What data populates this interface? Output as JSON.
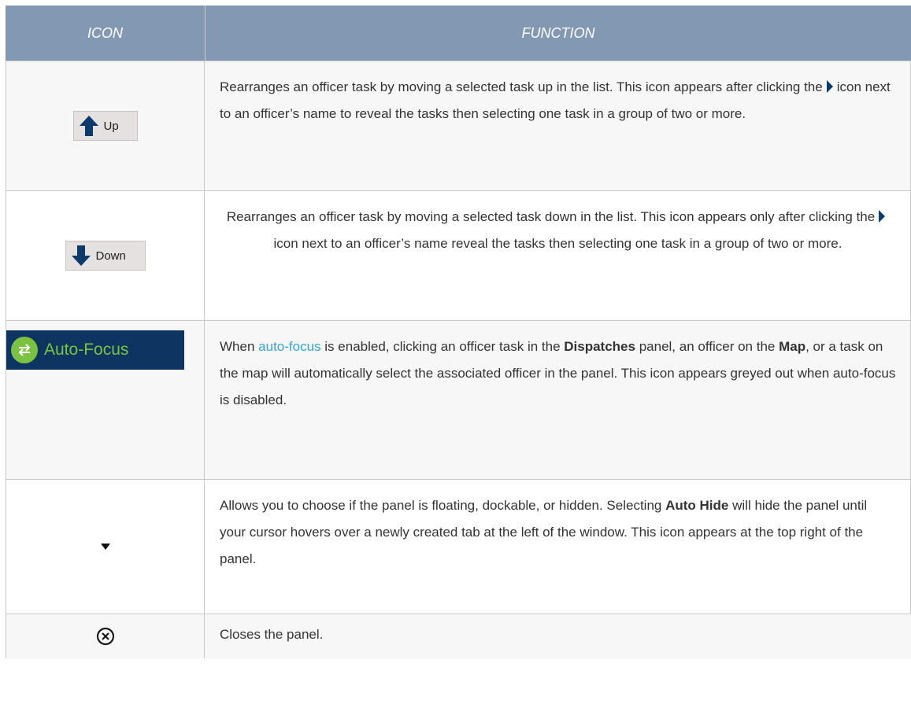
{
  "header": {
    "icon_col": "ICON",
    "function_col": "FUNCTION"
  },
  "rows": [
    {
      "button_label": "Up",
      "text_a": "Rearranges an officer task by moving a selected task up in the list. This icon appears after clicking the",
      "text_b": "icon next to an officer’s name to reveal the tasks then selecting one task in a group of two or more."
    },
    {
      "button_label": "Down",
      "text_a": "Rearranges an officer task by moving a selected task down in the list. This icon appears only after clicking the",
      "text_b": "icon next to an officer’s name reveal the tasks then selecting one task in a group of two or more."
    },
    {
      "button_label": "Auto-Focus",
      "text_a": "When",
      "link": "auto-focus",
      "text_b": "is enabled, clicking an officer task in the",
      "bold_1": "Dispatches",
      "text_c": "panel, an officer on the",
      "bold_2": "Map",
      "text_d": ", or a task on the map will automatically select the associated officer in the panel. This icon appears greyed out when auto-focus is disabled."
    },
    {
      "text_a": "Allows you to choose if the panel is floating, dockable, or hidden. Selecting",
      "bold_1": "Auto Hide",
      "text_b": "will hide the panel until your cursor hovers over a newly created tab at the left of the window. This icon appears at the top right of the panel."
    },
    {
      "text_a": "Closes the panel."
    }
  ],
  "colors": {
    "header_bg": "#8399b3",
    "link": "#2aa7df",
    "autofocus_bg": "#0e3562",
    "autofocus_green": "#7cc242",
    "arrow_blue": "#0b3a6b"
  }
}
